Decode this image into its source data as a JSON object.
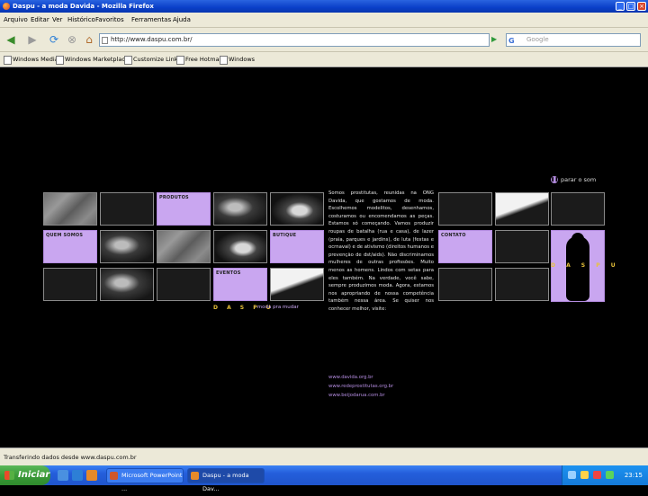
{
  "window": {
    "title": "Daspu - a moda Davida - Mozilla Firefox"
  },
  "menu": [
    "Arquivo",
    "Editar",
    "Ver",
    "Histórico",
    "Favoritos",
    "Ferramentas",
    "Ajuda"
  ],
  "navigation": {
    "url": "http://www.daspu.com.br/",
    "search_placeholder": "Google"
  },
  "bookmarks": [
    "Windows Media",
    "Windows Marketplace",
    "Customize Links",
    "Free Hotmail",
    "Windows"
  ],
  "site": {
    "sound_toggle": "parar o som",
    "tiles": {
      "produtos": "PRODUTOS",
      "quem_somos": "QUEM SOMOS",
      "butique": "BUTIQUE",
      "eventos": "EVENTOS",
      "contato": "CONTATO"
    },
    "logo": "D A S P U",
    "tagline": "- moda pra mudar",
    "about": "Somos prostitutas, reunidas na ONG Davida, que gostamos de moda. Escolhemos modelitos, desenhamos, costuramos ou encomendamos as peças. Estamos só começando. Vamos produzir roupas de batalha (rua e casa), de lazer (praia, parques e jardins), de luta (festas e ocrnaval) e de ativismo (direitos humanos e prevenção de dst/aids). Não discriminamos mulheres de outras profissões. Muito menos as homens. Lindos com setas para eles também. Na verdade, você sabe, sempre produzimos moda. Agora, estamos nos apropriando de nossa competência também nessa área. Se quiser nos conhecer melhor, visite:",
    "links": [
      "www.davida.org.br",
      "www.redeprostitutas.org.br",
      "www.beijodarua.com.br"
    ]
  },
  "status": "Transferindo dados desde www.daspu.com.br",
  "taskbar": {
    "start": "Iniciar",
    "tasks": [
      "Microsoft PowerPoint ...",
      "Daspu - a moda Dav..."
    ],
    "clock": "23:15"
  }
}
